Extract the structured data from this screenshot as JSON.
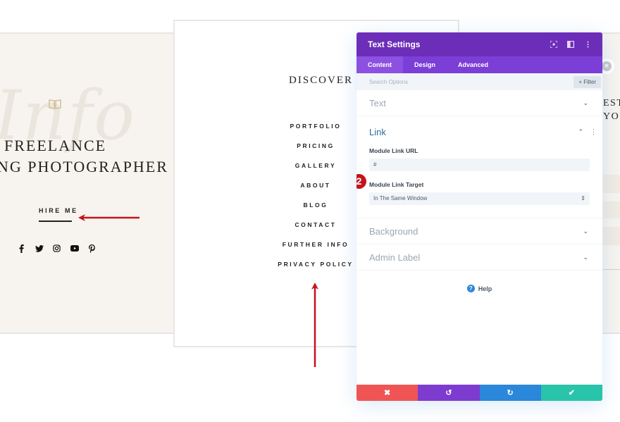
{
  "left_card": {
    "script_text": "Info",
    "hero_line1": "FREELANCE",
    "hero_line2": "NG PHOTOGRAPHER",
    "cta_label": "HIRE ME",
    "socials": [
      "facebook-icon",
      "twitter-icon",
      "instagram-icon",
      "youtube-icon",
      "pinterest-icon"
    ]
  },
  "middle_card": {
    "heading": "DISCOVER",
    "menu": [
      "PORTFOLIO",
      "PRICING",
      "GALLERY",
      "ABOUT",
      "BLOG",
      "CONTACT",
      "FURTHER INFO",
      "PRIVACY POLICY"
    ]
  },
  "right_card": {
    "line1": "EST",
    "line2": "YOUR"
  },
  "panel": {
    "title": "Text Settings",
    "header_icons": [
      "focus-icon",
      "split-view-icon",
      "more-options-icon"
    ],
    "tabs": [
      {
        "label": "Content",
        "active": true
      },
      {
        "label": "Design",
        "active": false
      },
      {
        "label": "Advanced",
        "active": false
      }
    ],
    "search_placeholder": "Search Options",
    "filter_label": "+ Filter",
    "sections": {
      "text": "Text",
      "link": "Link",
      "background": "Background",
      "admin_label": "Admin Label"
    },
    "link_fields": {
      "url_label": "Module Link URL",
      "url_value": "#",
      "target_label": "Module Link Target",
      "target_value": "In The Same Window"
    },
    "step_badge": "2",
    "help_label": "Help",
    "footer": {
      "cancel": "✖",
      "undo": "↺",
      "redo": "↻",
      "save": "✔"
    }
  },
  "colors": {
    "header_purple": "#6c2eb9",
    "tab_purple": "#7b3ed6",
    "cancel_red": "#ef5555",
    "undo_purple": "#7e3bd0",
    "redo_blue": "#2b87da",
    "save_green": "#29c4a9",
    "annotation_red": "#c4131b"
  }
}
